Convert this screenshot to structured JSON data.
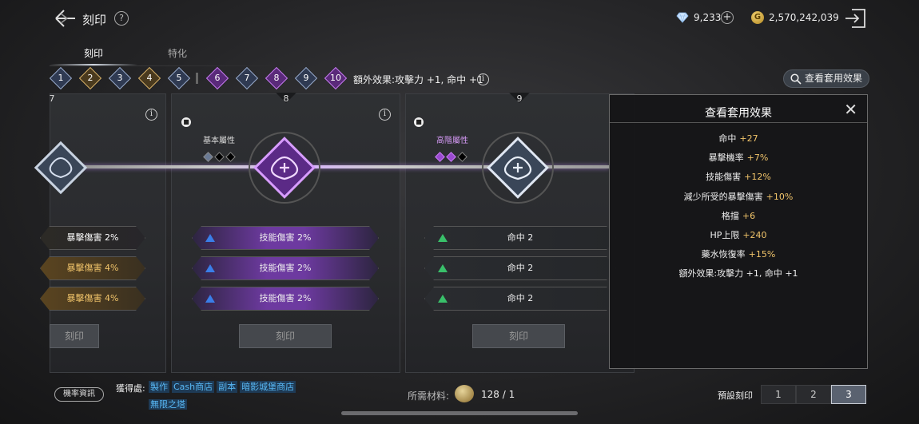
{
  "header": {
    "title": "刻印",
    "help": "?"
  },
  "currency": {
    "gems": "9,233",
    "gold": "2,570,242,039",
    "gold_symbol": "G"
  },
  "tabs": [
    {
      "label": "刻印"
    },
    {
      "label": "特化"
    }
  ],
  "set_pieces": [
    "1",
    "2",
    "3",
    "4",
    "5",
    "6",
    "7",
    "8",
    "9",
    "10"
  ],
  "set_bonus": "額外效果:攻擊力 +1, 命中 +1",
  "view_button": "查看套用效果",
  "cards": [
    {
      "number": "7",
      "rows": [
        "暴擊傷害 2%",
        "暴擊傷害 4%",
        "暴擊傷害 4%"
      ],
      "button": "刻印"
    },
    {
      "number": "8",
      "attr": "基本屬性",
      "rows": [
        "技能傷害 2%",
        "技能傷害 2%",
        "技能傷害 2%"
      ],
      "button": "刻印"
    },
    {
      "number": "9",
      "attr": "高階屬性",
      "rows": [
        "命中 2",
        "命中 2",
        "命中 2"
      ],
      "button": "刻印"
    }
  ],
  "popup": {
    "title": "查看套用效果",
    "items": [
      {
        "label": "命中",
        "value": "+27"
      },
      {
        "label": "暴擊機率",
        "value": "+7%"
      },
      {
        "label": "技能傷害",
        "value": "+12%"
      },
      {
        "label": "減少所受的暴擊傷害",
        "value": "+10%"
      },
      {
        "label": "格擋",
        "value": "+6"
      },
      {
        "label": "HP上限",
        "value": "+240"
      },
      {
        "label": "藥水恢復率",
        "value": "+15%"
      },
      {
        "label": "額外效果:攻擊力 +1, 命中 +1",
        "value": ""
      }
    ]
  },
  "footer": {
    "prob_button": "機率資訊",
    "obtain_label": "獲得處:",
    "sources": [
      "製作",
      "Cash商店",
      "副本",
      "暗影城堡商店",
      "無限之塔"
    ],
    "material_label": "所需材料:",
    "material_value": "128 / 1",
    "preset_label": "預設刻印",
    "presets": [
      "1",
      "2",
      "3"
    ]
  }
}
